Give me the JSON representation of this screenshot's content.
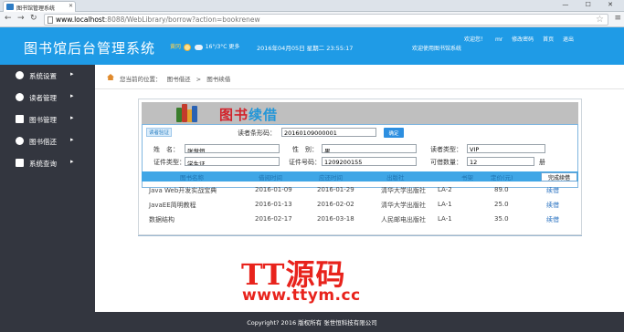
{
  "browser": {
    "tab_title": "图书馆管理系统",
    "url_host": "www.localhost",
    "url_path": ":8088/WebLibrary/borrow?action=bookrenew",
    "window_controls": "— ☐ ✕"
  },
  "header": {
    "title": "图书馆后台管理系统",
    "weather_city": "黄冈",
    "weather_temp": "16°/3°C",
    "weather_more": "更多",
    "datetime": "2016年04月05日 星期二 23:55:17",
    "welcome_system": "欢迎使用图书馆系统",
    "welcome_user": "欢迎您！",
    "username": "mr",
    "change_password": "修改密码",
    "home": "首页",
    "logout": "退出"
  },
  "sidebar": {
    "items": [
      {
        "label": "系统设置",
        "icon": "gear-icon"
      },
      {
        "label": "读者管理",
        "icon": "reader-icon"
      },
      {
        "label": "图书管理",
        "icon": "books-icon"
      },
      {
        "label": "图书借还",
        "icon": "exchange-icon"
      },
      {
        "label": "系统查询",
        "icon": "search-icon"
      }
    ]
  },
  "breadcrumb": {
    "prefix": "您当前的位置：",
    "level1": "图书借还",
    "sep": ">",
    "level2": "图书续借"
  },
  "panel": {
    "title_part1": "图书",
    "title_part2": "续借",
    "tag": "读者验证",
    "confirm_button": "确定"
  },
  "form": {
    "barcode_label": "读者条形码：",
    "barcode_value": "20160109000001",
    "name_label": "姓　名：",
    "name_value": "张世恒",
    "gender_label": "性　别：",
    "gender_value": "男",
    "reader_type_label": "读者类型：",
    "reader_type_value": "VIP",
    "cert_type_label": "证件类型：",
    "cert_type_value": "学生证",
    "cert_no_label": "证件号码：",
    "cert_no_value": "1209200155",
    "borrow_limit_label": "可借数量：",
    "borrow_limit_value": "12",
    "borrow_limit_unit": "册"
  },
  "table": {
    "headers": [
      "图书名称",
      "借阅时间",
      "应还时间",
      "出版社",
      "书架",
      "定价(元)"
    ],
    "renew_all": "完成续借",
    "rows": [
      {
        "name": "Java Web开发实战宝典",
        "borrow": "2016-01-09",
        "due": "2016-01-29",
        "publisher": "清华大学出版社",
        "shelf": "LA-2",
        "price": "89.0",
        "action": "续借"
      },
      {
        "name": "JavaEE简明教程",
        "borrow": "2016-01-13",
        "due": "2016-02-02",
        "publisher": "清华大学出版社",
        "shelf": "LA-1",
        "price": "25.0",
        "action": "续借"
      },
      {
        "name": "数据结构",
        "borrow": "2016-02-17",
        "due": "2016-03-18",
        "publisher": "人民邮电出版社",
        "shelf": "LA-1",
        "price": "35.0",
        "action": "续借"
      }
    ]
  },
  "watermark": {
    "brand": "TT源码",
    "site": "www.ttym.cc"
  },
  "footer": {
    "copyright": "Copyright? 2016 版权所有 张世恒科技有限公司"
  },
  "colors": {
    "header_blue": "#1f9be6",
    "sidebar_dark": "#33363f",
    "title_red": "#d2222a",
    "title_blue": "#2296d8",
    "watermark_red": "#e8231c"
  }
}
